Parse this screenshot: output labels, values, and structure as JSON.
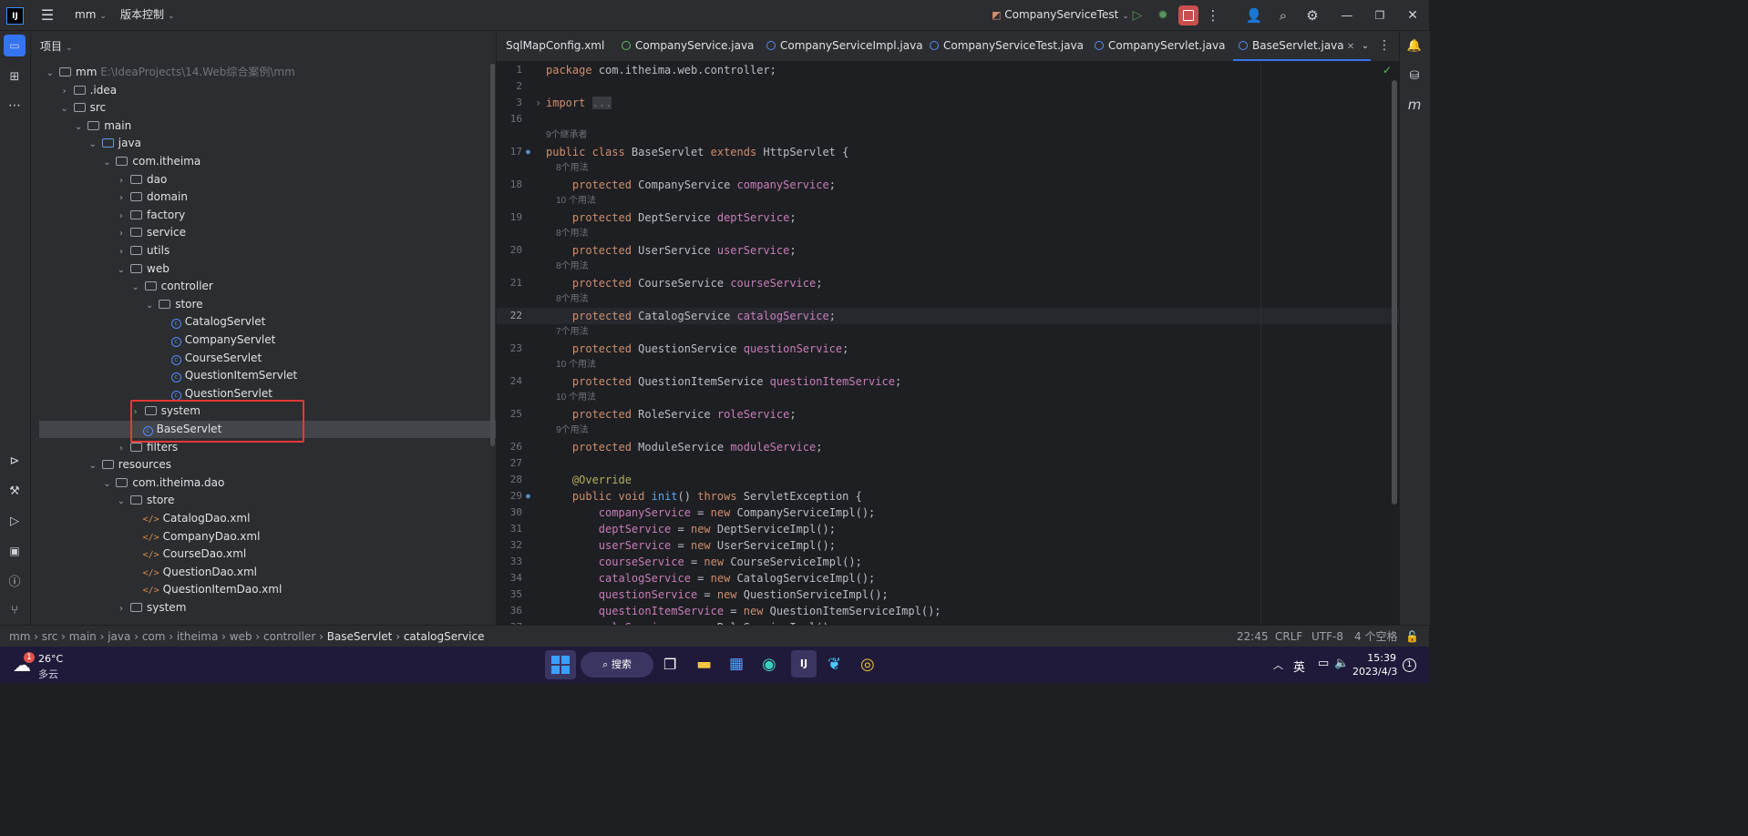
{
  "topbar": {
    "project": "mm",
    "vcs": "版本控制",
    "run_config": "CompanyServiceTest"
  },
  "project_panel": {
    "title": "项目",
    "tree": [
      {
        "label": "mm",
        "extra": "E:\\IdeaProjects\\14.Web综合案例\\mm",
        "arrow": "v",
        "icon": "folder"
      },
      {
        "label": ".idea",
        "arrow": ">",
        "icon": "folder"
      },
      {
        "label": "src",
        "arrow": "v",
        "icon": "folder"
      },
      {
        "label": "main",
        "arrow": "v",
        "icon": "folder"
      },
      {
        "label": "java",
        "arrow": "v",
        "icon": "folder-blue"
      },
      {
        "label": "com.itheima",
        "arrow": "v",
        "icon": "package"
      },
      {
        "label": "dao",
        "arrow": ">",
        "icon": "package"
      },
      {
        "label": "domain",
        "arrow": ">",
        "icon": "package"
      },
      {
        "label": "factory",
        "arrow": ">",
        "icon": "package"
      },
      {
        "label": "service",
        "arrow": ">",
        "icon": "package"
      },
      {
        "label": "utils",
        "arrow": ">",
        "icon": "package"
      },
      {
        "label": "web",
        "arrow": "v",
        "icon": "package"
      },
      {
        "label": "controller",
        "arrow": "v",
        "icon": "package"
      },
      {
        "label": "store",
        "arrow": "v",
        "icon": "package"
      },
      {
        "label": "CatalogServlet",
        "arrow": "",
        "icon": "class"
      },
      {
        "label": "CompanyServlet",
        "arrow": "",
        "icon": "class"
      },
      {
        "label": "CourseServlet",
        "arrow": "",
        "icon": "class"
      },
      {
        "label": "QuestionItemServlet",
        "arrow": "",
        "icon": "class"
      },
      {
        "label": "QuestionServlet",
        "arrow": "",
        "icon": "class"
      },
      {
        "label": "system",
        "arrow": ">",
        "icon": "package"
      },
      {
        "label": "BaseServlet",
        "arrow": "",
        "icon": "class"
      },
      {
        "label": "filters",
        "arrow": ">",
        "icon": "package"
      },
      {
        "label": "resources",
        "arrow": "v",
        "icon": "folder"
      },
      {
        "label": "com.itheima.dao",
        "arrow": "v",
        "icon": "package"
      },
      {
        "label": "store",
        "arrow": "v",
        "icon": "package"
      },
      {
        "label": "CatalogDao.xml",
        "arrow": "",
        "icon": "xml"
      },
      {
        "label": "CompanyDao.xml",
        "arrow": "",
        "icon": "xml"
      },
      {
        "label": "CourseDao.xml",
        "arrow": "",
        "icon": "xml"
      },
      {
        "label": "QuestionDao.xml",
        "arrow": "",
        "icon": "xml"
      },
      {
        "label": "QuestionItemDao.xml",
        "arrow": "",
        "icon": "xml"
      },
      {
        "label": "system",
        "arrow": ">",
        "icon": "package"
      }
    ]
  },
  "tabs": [
    {
      "label": "SqlMapConfig.xml",
      "icon": "xml"
    },
    {
      "label": "CompanyService.java",
      "icon": "interface"
    },
    {
      "label": "CompanyServiceImpl.java",
      "icon": "class"
    },
    {
      "label": "CompanyServiceTest.java",
      "icon": "class"
    },
    {
      "label": "CompanyServlet.java",
      "icon": "class"
    },
    {
      "label": "BaseServlet.java",
      "icon": "class",
      "active": true
    }
  ],
  "editor": {
    "lines": [
      {
        "n": "1",
        "html": "<span class='kw'>package</span> com.itheima.web.controller;"
      },
      {
        "n": "2",
        "html": ""
      },
      {
        "n": "3",
        "html": "<span class='kw'>import</span> <span style='background:#393b40;color:#6f737a'>...</span>"
      },
      {
        "n": "16",
        "html": ""
      },
      {
        "hint": "9个继承者"
      },
      {
        "n": "17",
        "html": "<span class='kw'>public class</span> BaseServlet <span class='kw'>extends</span> HttpServlet {"
      },
      {
        "hint": "    8个用法"
      },
      {
        "n": "18",
        "html": "    <span class='kw'>protected</span> CompanyService <span class='fld'>companyService</span>;"
      },
      {
        "hint": "    10 个用法"
      },
      {
        "n": "19",
        "html": "    <span class='kw'>protected</span> DeptService <span class='fld'>deptService</span>;"
      },
      {
        "hint": "    8个用法"
      },
      {
        "n": "20",
        "html": "    <span class='kw'>protected</span> UserService <span class='fld'>userService</span>;"
      },
      {
        "hint": "    8个用法"
      },
      {
        "n": "21",
        "html": "    <span class='kw'>protected</span> CourseService <span class='fld'>courseService</span>;"
      },
      {
        "hint": "    8个用法"
      },
      {
        "n": "22",
        "html": "    <span class='kw'>protected</span> CatalogService <span class='fld'>catalogService</span>;",
        "current": true
      },
      {
        "hint": "    7个用法"
      },
      {
        "n": "23",
        "html": "    <span class='kw'>protected</span> QuestionService <span class='fld'>questionService</span>;"
      },
      {
        "hint": "    10 个用法"
      },
      {
        "n": "24",
        "html": "    <span class='kw'>protected</span> QuestionItemService <span class='fld'>questionItemService</span>;"
      },
      {
        "hint": "    10 个用法"
      },
      {
        "n": "25",
        "html": "    <span class='kw'>protected</span> RoleService <span class='fld'>roleService</span>;"
      },
      {
        "hint": "    9个用法"
      },
      {
        "n": "26",
        "html": "    <span class='kw'>protected</span> ModuleService <span class='fld'>moduleService</span>;"
      },
      {
        "n": "27",
        "html": ""
      },
      {
        "n": "28",
        "html": "    <span class='ann'>@Override</span>"
      },
      {
        "n": "29",
        "html": "    <span class='kw'>public void</span> <span class='mth'>init</span>() <span class='kw'>throws</span> ServletException {"
      },
      {
        "n": "30",
        "html": "        <span class='fld'>companyService</span> = <span class='kw'>new</span> CompanyServiceImpl();"
      },
      {
        "n": "31",
        "html": "        <span class='fld'>deptService</span> = <span class='kw'>new</span> DeptServiceImpl();"
      },
      {
        "n": "32",
        "html": "        <span class='fld'>userService</span> = <span class='kw'>new</span> UserServiceImpl();"
      },
      {
        "n": "33",
        "html": "        <span class='fld'>courseService</span> = <span class='kw'>new</span> CourseServiceImpl();"
      },
      {
        "n": "34",
        "html": "        <span class='fld'>catalogService</span> = <span class='kw'>new</span> CatalogServiceImpl();"
      },
      {
        "n": "35",
        "html": "        <span class='fld'>questionService</span> = <span class='kw'>new</span> QuestionServiceImpl();"
      },
      {
        "n": "36",
        "html": "        <span class='fld'>questionItemService</span> = <span class='kw'>new</span> QuestionItemServiceImpl();"
      },
      {
        "n": "37",
        "html": "        <span class='fld'>roleService</span> = <span class='kw'>new</span> RoleServiceImpl();"
      }
    ]
  },
  "breadcrumbs": [
    "mm",
    "src",
    "main",
    "java",
    "com",
    "itheima",
    "web",
    "controller",
    "BaseServlet",
    "catalogService"
  ],
  "status": {
    "position": "22:45",
    "line_sep": "CRLF",
    "encoding": "UTF-8",
    "indent": "4 个空格"
  },
  "taskbar": {
    "weather_temp": "26°C",
    "weather_desc": "多云",
    "weather_badge": "1",
    "search": "搜索",
    "ime": "英",
    "time": "15:39",
    "date": "2023/4/3",
    "notif": "1"
  }
}
